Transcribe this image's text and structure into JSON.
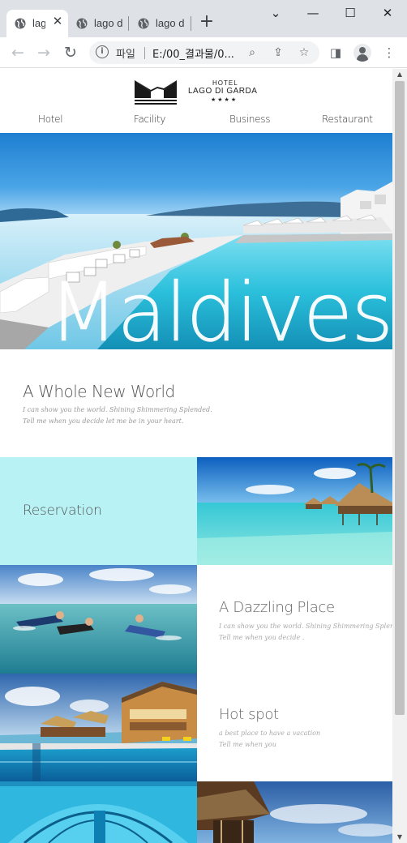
{
  "browser": {
    "tabs": [
      {
        "label": "lag",
        "active": true
      },
      {
        "label": "lago d",
        "active": false
      },
      {
        "label": "lago d",
        "active": false
      }
    ],
    "new_tab_icon": "plus-icon",
    "window": {
      "chevron": "⌄",
      "minimize": "—",
      "maximize": "☐",
      "close": "✕"
    },
    "address": {
      "scheme_label": "파일",
      "url": "E:/00_결과물/0..."
    },
    "colors": {
      "chrome_bg": "#dee1e6",
      "omnibox_bg": "#f1f3f4"
    }
  },
  "site": {
    "logo": {
      "hotel": "HOTEL",
      "name": "LAGO DI GARDA",
      "stars": "★★★★"
    },
    "nav": [
      "Hotel",
      "Facility",
      "Business",
      "Restaurant"
    ],
    "hero_title": "Maldives",
    "intro": {
      "heading": "A Whole New World",
      "line1": "I can show you the world. Shining Shimmering Splended.",
      "line2": "Tell me when you decide let me be in your heart."
    },
    "reservation_label": "Reservation",
    "dazzling": {
      "heading": "A Dazzling Place",
      "line1": "I can show you the world. Shining Shimmering Splended.",
      "line2": "Tell me when you decide ."
    },
    "hotspot": {
      "heading": "Hot spot",
      "line1": "a best place to have a vacation",
      "line2": "Tell me when you"
    },
    "colors": {
      "reservation_bg": "#b8f2f4",
      "heading_gray": "#555555"
    }
  }
}
